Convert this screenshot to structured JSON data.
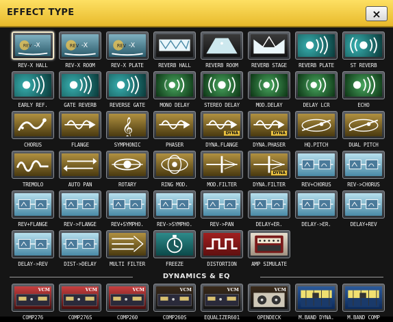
{
  "window": {
    "title": "EFFECT TYPE",
    "close_label": "×"
  },
  "effects": [
    {
      "label": "REV-X HALL",
      "selected": true,
      "art": "a-rev",
      "icon": "rev-x-icon"
    },
    {
      "label": "REV-X ROOM",
      "art": "a-rev",
      "icon": "rev-x-icon"
    },
    {
      "label": "REV-X PLATE",
      "art": "a-rev",
      "icon": "rev-x-icon"
    },
    {
      "label": "REVERB HALL",
      "art": "a-dark",
      "icon": "hall-icon"
    },
    {
      "label": "REVERB ROOM",
      "art": "a-dark",
      "icon": "room-icon"
    },
    {
      "label": "REVERB STAGE",
      "art": "a-dark",
      "icon": "stage-icon"
    },
    {
      "label": "REVERB PLATE",
      "art": "a-teal",
      "icon": "speaker-waves-icon"
    },
    {
      "label": "ST REVERB",
      "art": "a-teal",
      "icon": "stereo-waves-icon"
    },
    {
      "label": "EARLY REF.",
      "art": "a-teal",
      "icon": "speaker-waves-icon"
    },
    {
      "label": "GATE REVERB",
      "art": "a-teal",
      "icon": "speaker-waves-icon"
    },
    {
      "label": "REVERSE GATE",
      "art": "a-teal",
      "icon": "speaker-waves-icon"
    },
    {
      "label": "MONO DELAY",
      "art": "a-green",
      "icon": "delay-waves-icon"
    },
    {
      "label": "STEREO DELAY",
      "art": "a-green",
      "icon": "stereo-waves-icon"
    },
    {
      "label": "MOD.DELAY",
      "art": "a-green",
      "icon": "delay-waves-icon"
    },
    {
      "label": "DELAY LCR",
      "art": "a-green",
      "icon": "delay-waves-icon"
    },
    {
      "label": "ECHO",
      "art": "a-green",
      "icon": "speaker-waves-icon"
    },
    {
      "label": "CHORUS",
      "art": "a-gold",
      "icon": "chorus-icon"
    },
    {
      "label": "FLANGE",
      "art": "a-gold",
      "icon": "wave-arrow-icon"
    },
    {
      "label": "SYMPHONIC",
      "art": "a-gold",
      "icon": "treble-clef-icon"
    },
    {
      "label": "PHASER",
      "art": "a-gold",
      "icon": "wave-arrow-icon"
    },
    {
      "label": "DYNA.FLANGE",
      "art": "a-gold",
      "icon": "wave-arrow-icon",
      "badge": "DYNA"
    },
    {
      "label": "DYNA.PHASER",
      "art": "a-gold",
      "icon": "wave-arrow-icon",
      "badge": "DYNA"
    },
    {
      "label": "HQ.PITCH",
      "art": "a-gold",
      "icon": "pitch-icon"
    },
    {
      "label": "DUAL PITCH",
      "art": "a-gold",
      "icon": "pitch-icon"
    },
    {
      "label": "TREMOLO",
      "art": "a-gold",
      "icon": "tremolo-icon"
    },
    {
      "label": "AUTO PAN",
      "art": "a-gold",
      "icon": "autopan-icon"
    },
    {
      "label": "ROTARY",
      "art": "a-gold",
      "icon": "rotary-icon"
    },
    {
      "label": "RING MOD.",
      "art": "a-gold",
      "icon": "ringmod-icon"
    },
    {
      "label": "MOD.FILTER",
      "art": "a-gold",
      "icon": "filter-icon"
    },
    {
      "label": "DYNA.FILTER",
      "art": "a-gold",
      "icon": "filter-icon",
      "badge": "DYNA"
    },
    {
      "label": "REV+CHORUS",
      "art": "a-blue",
      "icon": "combo-icon"
    },
    {
      "label": "REV->CHORUS",
      "art": "a-blue",
      "icon": "combo-icon"
    },
    {
      "label": "REV+FLANGE",
      "art": "a-blue",
      "icon": "combo-icon"
    },
    {
      "label": "REV->FLANGE",
      "art": "a-blue",
      "icon": "combo-icon"
    },
    {
      "label": "REV+SYMPHO.",
      "art": "a-blue",
      "icon": "combo-icon"
    },
    {
      "label": "REV->SYMPHO.",
      "art": "a-blue",
      "icon": "combo-icon"
    },
    {
      "label": "REV->PAN",
      "art": "a-blue",
      "icon": "combo-icon"
    },
    {
      "label": "DELAY+ER.",
      "art": "a-blue",
      "icon": "combo-icon"
    },
    {
      "label": "DELAY->ER.",
      "art": "a-blue",
      "icon": "combo-icon"
    },
    {
      "label": "DELAY+REV",
      "art": "a-blue",
      "icon": "combo-icon"
    },
    {
      "label": "DELAY->REV",
      "art": "a-blue",
      "icon": "combo-icon"
    },
    {
      "label": "DIST->DELAY",
      "art": "a-blue",
      "icon": "combo-icon"
    },
    {
      "label": "MULTI FILTER",
      "art": "a-gold",
      "icon": "multifilter-icon"
    },
    {
      "label": "FREEZE",
      "art": "a-freeze",
      "icon": "stopwatch-icon"
    },
    {
      "label": "DISTORTION",
      "art": "a-red",
      "icon": "square-wave-icon"
    },
    {
      "label": "AMP SIMULATE",
      "art": "a-amp",
      "icon": "amp-icon"
    }
  ],
  "section_label": "DYNAMICS & EQ",
  "dynamics": [
    {
      "label": "COMP276",
      "art": "a-vcm",
      "icon": "vcm-rack-icon",
      "badge": "VCM"
    },
    {
      "label": "COMP276S",
      "art": "a-vcm",
      "icon": "vcm-rack-icon",
      "badge": "VCM"
    },
    {
      "label": "COMP260",
      "art": "a-vcm",
      "icon": "vcm-rack-icon",
      "badge": "VCM"
    },
    {
      "label": "COMP260S",
      "art": "a-vcm2",
      "icon": "vcm-rack-icon",
      "badge": "VCM"
    },
    {
      "label": "EQUALIZER601",
      "art": "a-vcm2",
      "icon": "vcm-rack-icon",
      "badge": "VCM"
    },
    {
      "label": "OPENDECK",
      "art": "a-vcm2",
      "icon": "tape-deck-icon",
      "badge": "VCM"
    },
    {
      "label": "M.BAND DYNA.",
      "art": "a-mb",
      "icon": "multiband-icon"
    },
    {
      "label": "M.BAND COMP",
      "art": "a-mb",
      "icon": "multiband-icon"
    }
  ]
}
